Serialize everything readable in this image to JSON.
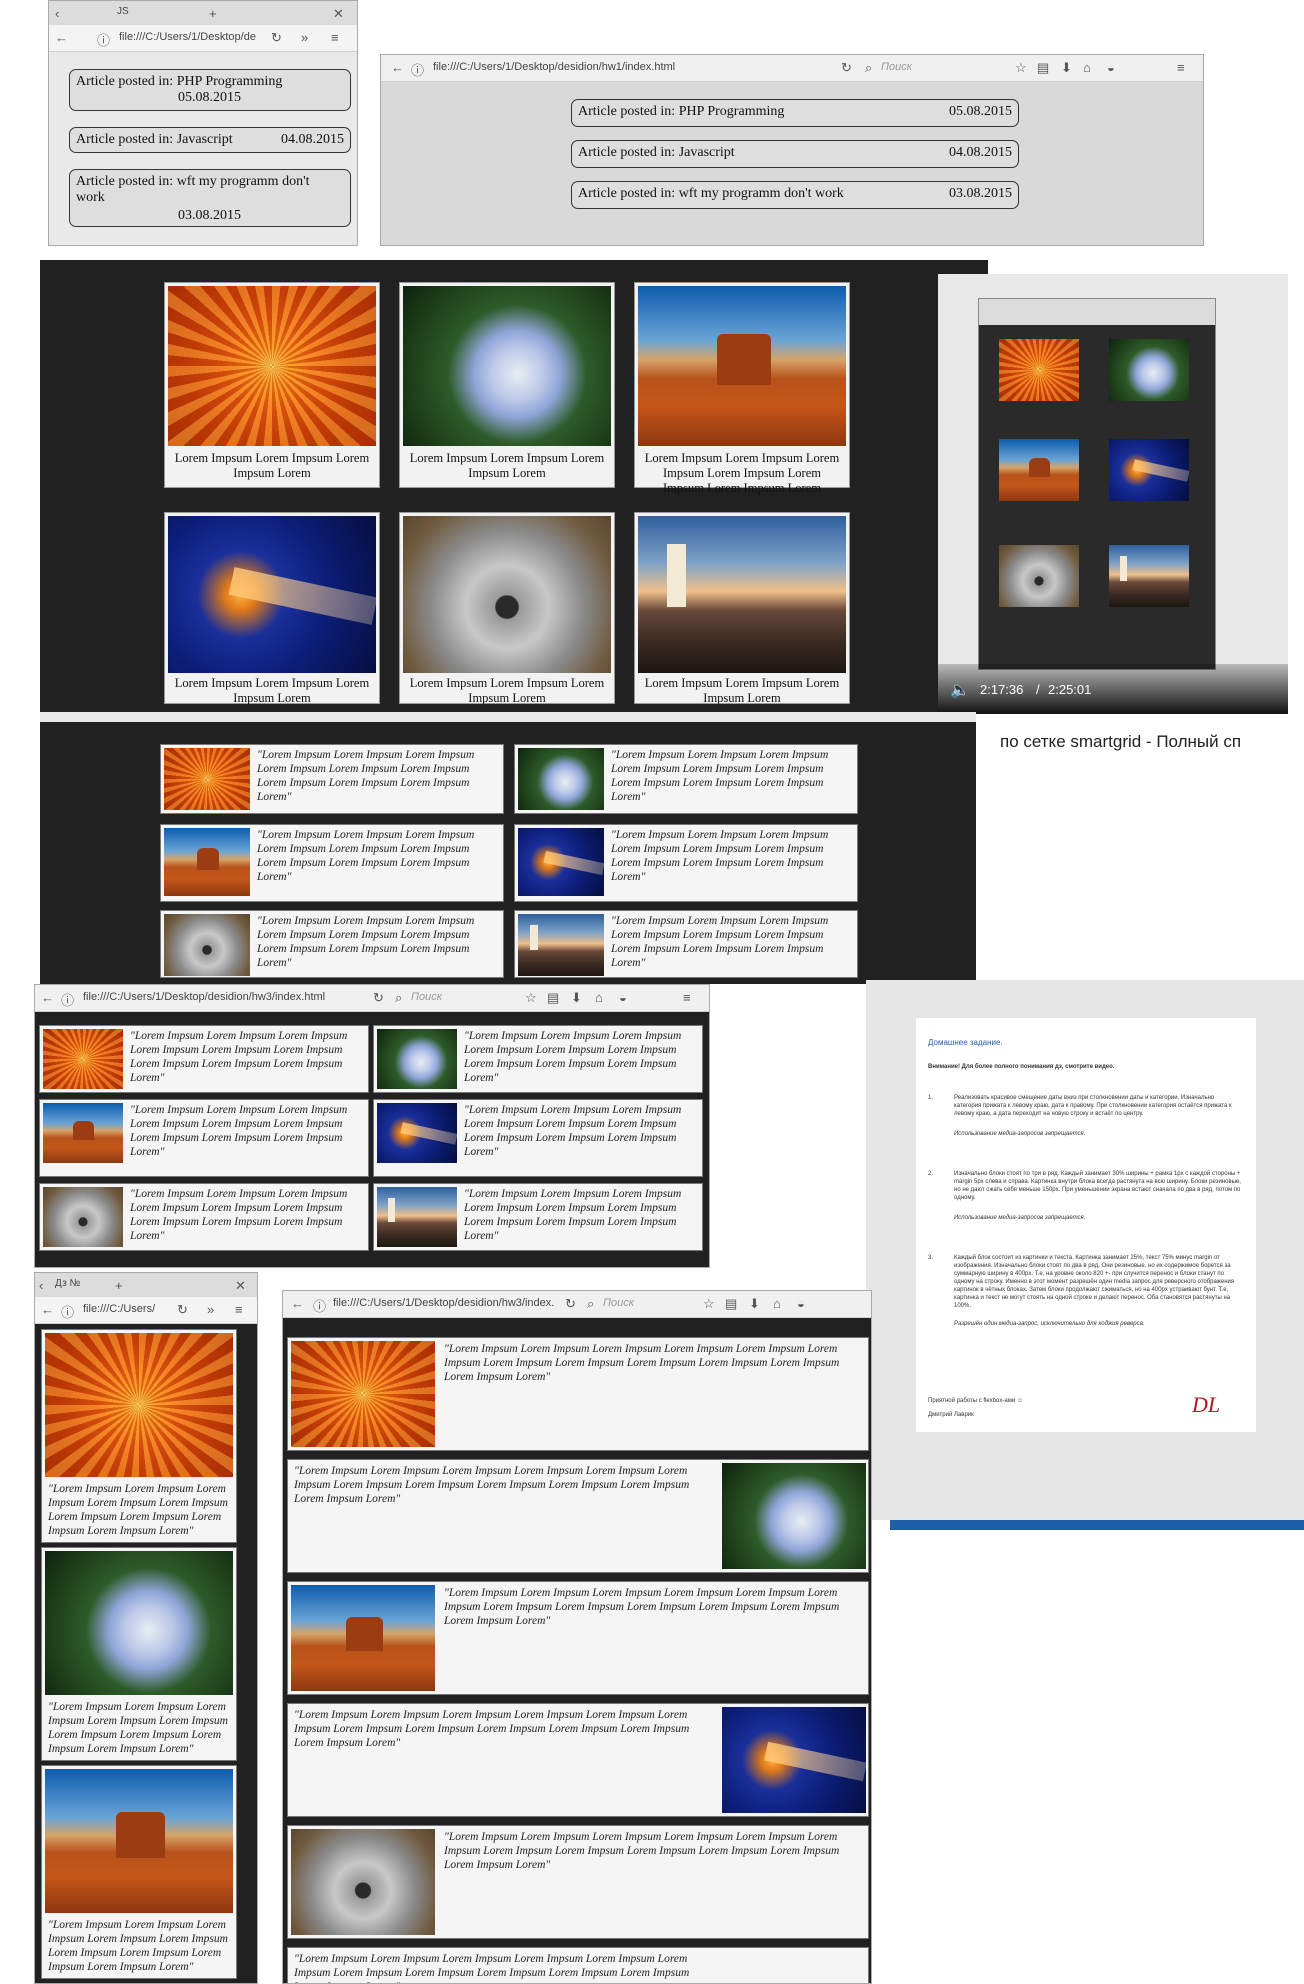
{
  "hw1": {
    "narrow_window": {
      "tab_label": "JS",
      "url": "file:///C:/Users/1/Desktop/de",
      "articles": [
        {
          "label": "Article posted in: PHP Programming",
          "date": "05.08.2015"
        },
        {
          "label": "Article posted in: Javascript",
          "date": "04.08.2015"
        },
        {
          "label": "Article posted in: wft my programm don't work",
          "date": "03.08.2015"
        }
      ]
    },
    "wide_window": {
      "url": "file:///C:/Users/1/Desktop/desidion/hw1/index.html",
      "search_placeholder": "Поиск",
      "articles": [
        {
          "label": "Article posted in: PHP Programming",
          "date": "05.08.2015"
        },
        {
          "label": "Article posted in: Javascript",
          "date": "04.08.2015"
        },
        {
          "label": "Article posted in: wft my programm don't work",
          "date": "03.08.2015"
        }
      ]
    }
  },
  "hw2": {
    "cards": [
      {
        "image": "flower",
        "caption": "Lorem Impsum Lorem Impsum Lorem Impsum Lorem"
      },
      {
        "image": "hydrangea",
        "caption": "Lorem Impsum Lorem Impsum Lorem Impsum Lorem"
      },
      {
        "image": "desert",
        "caption": "Lorem Impsum Lorem Impsum Lorem Impsum Lorem Impsum Lorem Impsum Lorem Impsum Lorem"
      },
      {
        "image": "jellyfish",
        "caption": "Lorem Impsum Lorem Impsum Lorem Impsum Lorem"
      },
      {
        "image": "koala",
        "caption": "Lorem Impsum Lorem Impsum Lorem Impsum Lorem"
      },
      {
        "image": "lighthouse",
        "caption": "Lorem Impsum Lorem Impsum Lorem Impsum Lorem"
      }
    ],
    "video": {
      "time": "2:17:36",
      "duration": "2:25:01",
      "video_text": "по сетке smartgrid - Полный сп"
    }
  },
  "hw3": {
    "url": "file:///C:/Users/1/Desktop/desidion/hw3/index.html",
    "url_short": "file:///C:/Users/1/Desktop/desidion/hw3/index.",
    "search_placeholder": "Поиск",
    "quote_short": "\"Lorem Impsum Lorem Impsum Lorem Impsum Lorem Impsum Lorem Impsum Lorem Impsum Lorem Impsum Lorem Impsum Lorem Impsum Lorem\"",
    "quote_long": "\"Lorem Impsum Lorem Impsum Lorem Impsum Lorem Impsum Lorem Impsum Lorem Impsum Lorem Impsum Lorem Impsum Lorem Impsum Lorem Impsum Lorem Impsum Lorem Impsum Lorem\"",
    "narrow_window": {
      "tab_label": "Дз №",
      "url": "file:///C:/Users/"
    }
  },
  "assignment": {
    "heading": "Домашнее задание.",
    "notice": "Внимание! Для более полного понимания дз, смотрите видео.",
    "items": [
      {
        "text": "Реализовать красивое смещение даты вниз при столкновении даты и категории. Изначально категория прижата к левому краю, дата к правому. При столкновении категория остаётся прижата к левому краю, а дата переходит на новую строку и встаёт по центру.",
        "note": "Использование медиа-запросов запрещается."
      },
      {
        "text": "Изначально блоки стоят по три в ряд. Каждый занимает 30% ширины + рамка 1px с каждой стороны + margin 5px слева и справа. Картинка внутри блока всегда растянута на всю ширину. Блоки резиновые, но не дают сжать себя меньше 150px. При уменьшении экрана встают сначала по два в ряд, потом по одному.",
        "note": "Использование медиа-запросов запрещается."
      },
      {
        "text": "Каждый блок состоит из картинки и текста. Картинка занимает 25%, текст 75% минус margin от изображения. Изначально блоки стоят по два в ряд. Они резиновые, но их содержимое борется за суммарную ширину в 400px. Т.е, на уровне около 820 +- при случится перенос и блоки станут по одному на строку. Именно в этот момент разрешён один media запрос для реверсного отображения картинок в чётных блоках. Затем блоки продолжают сжиматься, но на 400px устраивают бунт. Т.е, картинка и текст не могут стоять на одной строке и делают перенос. Оба становятся растянуты на 100%.",
        "note": "Разрешён один медиа-запрос, исключительно для ходжия реверса."
      }
    ],
    "footer": "Приятной работы с flexbox-ами ☺",
    "author": "Дмитрий Лаврик",
    "logo_text": "DL"
  },
  "colors": {
    "dark_bg": "#212121",
    "accent_blue": "#1c5fa8"
  }
}
